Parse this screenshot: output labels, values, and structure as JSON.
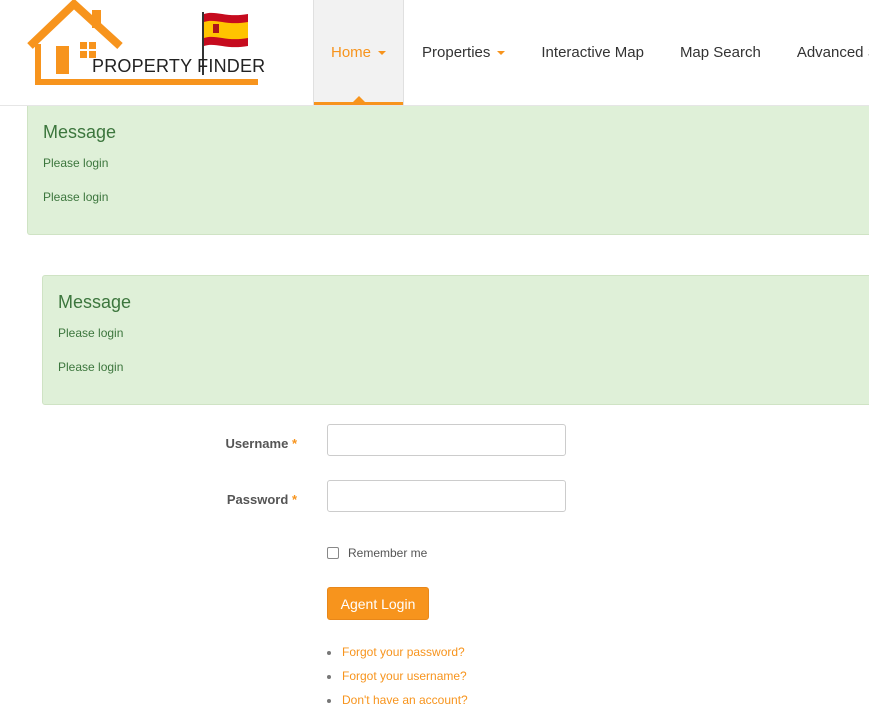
{
  "logo": {
    "text": "PROPERTY FINDER"
  },
  "nav": {
    "items": [
      {
        "label": "Home",
        "has_caret": true,
        "active": true
      },
      {
        "label": "Properties",
        "has_caret": true,
        "active": false
      },
      {
        "label": "Interactive Map",
        "has_caret": false,
        "active": false
      },
      {
        "label": "Map Search",
        "has_caret": false,
        "active": false
      },
      {
        "label": "Advanced Sea",
        "has_caret": false,
        "active": false
      }
    ]
  },
  "alerts": [
    {
      "title": "Message",
      "messages": [
        "Please login",
        "Please login"
      ]
    },
    {
      "title": "Message",
      "messages": [
        "Please login",
        "Please login"
      ]
    }
  ],
  "form": {
    "username_label": "Username",
    "password_label": "Password",
    "required_mark": "*",
    "username_value": "",
    "password_value": "",
    "remember_label": "Remember me",
    "submit_label": "Agent Login"
  },
  "links": [
    "Forgot your password?",
    "Forgot your username?",
    "Don't have an account?"
  ],
  "colors": {
    "accent": "#f7941d",
    "success_bg": "#dff0d8",
    "success_text": "#3c763d"
  }
}
